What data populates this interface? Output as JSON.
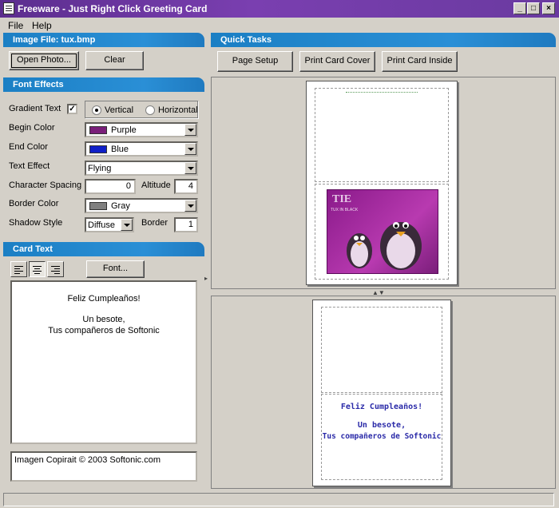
{
  "window": {
    "title": "Freeware - Just Right Click Greeting Card",
    "buttons": {
      "minimize": "_",
      "maximize": "□",
      "close": "×"
    }
  },
  "menu": {
    "file": "File",
    "help": "Help"
  },
  "image_panel": {
    "header": "Image File: tux.bmp",
    "open_label": "Open Photo...",
    "clear_label": "Clear"
  },
  "font_effects": {
    "header": "Font Effects",
    "gradient_text_label": "Gradient Text",
    "gradient_checked": "✓",
    "vertical_label": "Vertical",
    "horizontal_label": "Horizontal",
    "begin_color_label": "Begin Color",
    "begin_color_value": "Purple",
    "begin_color_hex": "#7a1f7a",
    "end_color_label": "End Color",
    "end_color_value": "Blue",
    "end_color_hex": "#1020c8",
    "text_effect_label": "Text Effect",
    "text_effect_value": "Flying",
    "char_spacing_label": "Character Spacing",
    "char_spacing_value": "0",
    "altitude_label": "Altitude",
    "altitude_value": "4",
    "border_color_label": "Border Color",
    "border_color_value": "Gray",
    "border_color_hex": "#808080",
    "shadow_style_label": "Shadow Style",
    "shadow_style_value": "Diffuse",
    "border_label": "Border",
    "border_value": "1"
  },
  "card_text": {
    "header": "Card Text",
    "font_button": "Font...",
    "line1": "Feliz Cumpleaños!",
    "line2": "Un besote,",
    "line3": "Tus compañeros de Softonic",
    "footer": "Imagen Copirait © 2003 Softonic.com"
  },
  "quick_tasks": {
    "header": "Quick Tasks",
    "page_setup": "Page Setup",
    "print_cover": "Print Card Cover",
    "print_inside": "Print Card Inside"
  },
  "preview": {
    "image_label": "TUX IN BLACK",
    "inside_line1": "Feliz Cumpleaños!",
    "inside_line2": "Un besote,",
    "inside_line3": "Tus compañeros de Softonic",
    "inside_color": "#2a2aa8"
  }
}
